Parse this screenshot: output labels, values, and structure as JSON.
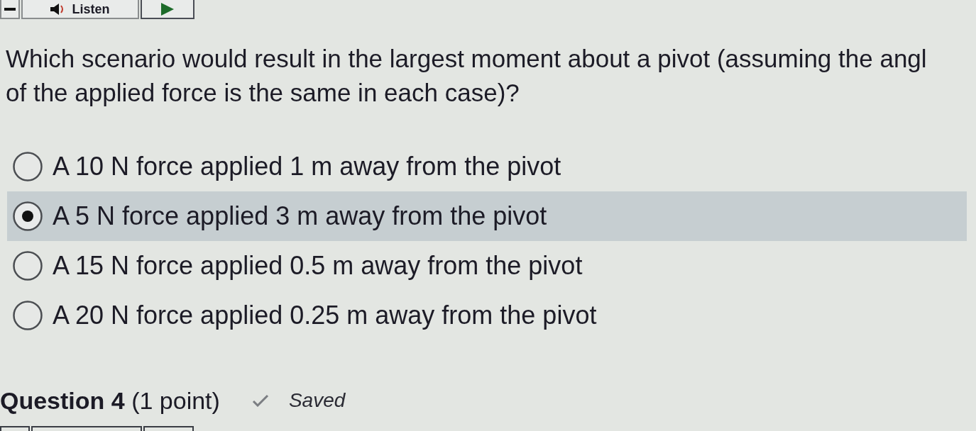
{
  "toolbar": {
    "listen_button": {
      "label": "Listen"
    }
  },
  "question": {
    "lines": [
      "Which scenario would result in the largest moment about a pivot (assuming the angl",
      "of the applied force is the same in each case)?"
    ],
    "options": [
      {
        "label": "A 10 N force applied 1 m away from the pivot",
        "selected": false
      },
      {
        "label": "A 5 N force applied 3 m away from the pivot",
        "selected": true
      },
      {
        "label": "A 15 N force applied 0.5 m away from the pivot",
        "selected": false
      },
      {
        "label": "A 20 N force applied 0.25 m away from the pivot",
        "selected": false
      }
    ]
  },
  "next_question": {
    "title": "**Question 4** (1 point)",
    "status": "Saved"
  }
}
